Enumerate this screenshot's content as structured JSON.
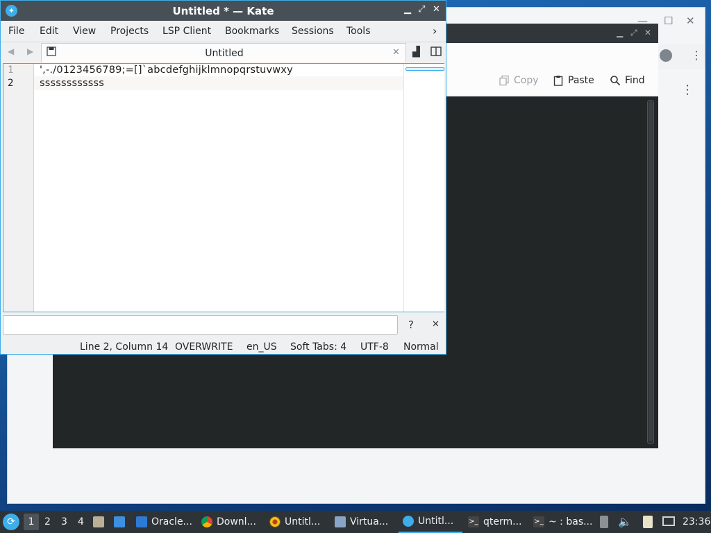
{
  "browser": {
    "min_icon": "minimize-icon",
    "max_icon": "maximize-icon",
    "close_icon": "close-icon"
  },
  "qterminal": {
    "actions": [
      {
        "label": "Copy",
        "icon": "copy-icon",
        "enabled": false
      },
      {
        "label": "Paste",
        "icon": "paste-icon",
        "enabled": true
      },
      {
        "label": "Find",
        "icon": "search-icon",
        "enabled": true
      }
    ],
    "colors": {
      "background": "#232627"
    }
  },
  "kate": {
    "title": "Untitled * — Kate",
    "menu": [
      "File",
      "Edit",
      "View",
      "Projects",
      "LSP Client",
      "Bookmarks",
      "Sessions",
      "Tools"
    ],
    "tab_label": "Untitled",
    "lines": [
      {
        "number": "1",
        "text": "',-./0123456789;=[]`abcdefghijklmnopqrstuvwxy"
      },
      {
        "number": "2",
        "text": "ssssssssssss"
      }
    ],
    "cmd_help": "?",
    "status": {
      "position": "Line 2, Column 14",
      "mode": "OVERWRITE",
      "language": "en_US",
      "indent": "Soft Tabs: 4",
      "encoding": "UTF-8",
      "input_mode": "Normal"
    },
    "accent": "#3daee9"
  },
  "taskbar": {
    "workspaces": [
      "1",
      "2",
      "3",
      "4"
    ],
    "tasks": [
      {
        "label": "Oracle...",
        "icon": "monitor-icon",
        "active": false
      },
      {
        "label": "Downl...",
        "icon": "chrome-icon",
        "active": false
      },
      {
        "label": "Untitl...",
        "icon": "app-icon",
        "active": false
      },
      {
        "label": "Virtua...",
        "icon": "virtualbox-icon",
        "active": false
      },
      {
        "label": "Untitl...",
        "icon": "kate-icon",
        "active": true
      },
      {
        "label": "qterm...",
        "icon": "terminal-icon",
        "active": false
      },
      {
        "label": "~ : bas...",
        "icon": "terminal-icon",
        "active": false
      }
    ],
    "clock": "23:36"
  }
}
